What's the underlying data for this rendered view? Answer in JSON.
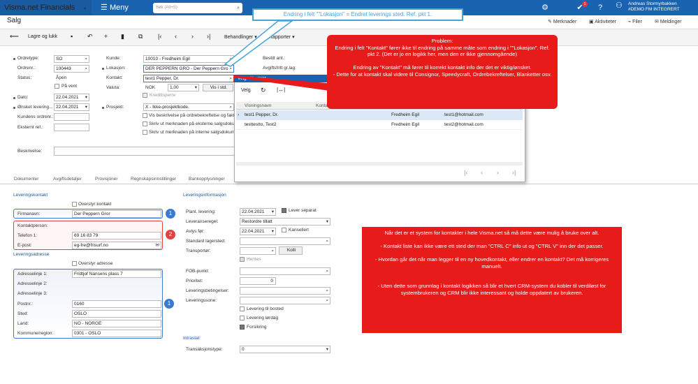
{
  "topbar": {
    "brand": "Visma.net Financials",
    "brand_chev": "⌄",
    "menu_label": "Meny",
    "search_placeholder": "Søk (Alt+S)",
    "user_name": "Andreas Stormyrbakken",
    "user_company": "#DEMO FM INTEGRERT",
    "notif_count": "1"
  },
  "header": {
    "title": "Salg",
    "buttons": [
      "Merknader",
      "Aktiviteter",
      "Filer",
      "Meldinger"
    ]
  },
  "toolbar": {
    "save_close": "Lagre og lukk",
    "actions": "Behandlinger",
    "reports": "Rapporter"
  },
  "form": {
    "ordertype_label": "Ordretype:",
    "ordertype": "SO",
    "ordernr_label": "Ordrenr.:",
    "ordernr": "100443",
    "status_label": "Status:",
    "status": "Åpen",
    "paavent": "På vent",
    "dato_label": "Dato:",
    "dato": "22.04.2021",
    "onsket_label": "Ønsket levering...",
    "onsket": "22.04.2021",
    "kundens_label": "Kundens ordrenr.:",
    "ekstern_label": "Eksternt ref.:",
    "kunde_label": "Kunde:",
    "kunde": "10010 - Fredheim Egil",
    "lokasjon_label": "Lokasjon:",
    "lokasjon": "DER PEPPERN GRO - Der Peppern Gro",
    "kontakt_label": "Kontakt:",
    "kontakt": "test1 Pepper, Dr.",
    "valuta_label": "Valuta:",
    "valuta": "NOK",
    "kurs": "1,00",
    "vis_std": "Vis i std.",
    "kredittsperre": "Kredittsperre",
    "prosjekt_label": "Prosjekt:",
    "prosjekt": "X - Ikke-prosjektkode.",
    "vis_besk": "Vis beskrivelse på ordrebekreftelse og faktura",
    "skriv_eksterne": "Skriv ut merknaden på eksterne salgsdokumenter",
    "skriv_interne": "Skriv ut merknaden på interne salgsdokumenter",
    "bestilt_label": "Bestilt ant.:",
    "avgift_label": "Avgiftsfritt gr.lag:",
    "beskrivelse_label": "Beskrivelse:"
  },
  "tabs": [
    "Dokumenter",
    "Avgiftsdetaljer",
    "Provisjoner",
    "Regnskapsinnstillinger",
    "Bankopplysninger"
  ],
  "popup": {
    "header": "Velg - Kontakt",
    "velg": "Velg",
    "col1": "Visningsnavn",
    "col2": "Kontakt",
    "rows": [
      {
        "name": "test1 Pepper, Dr.",
        "customer": "Fredheim Egil",
        "email": "test1@hotmail.com"
      },
      {
        "name": "testtestto, Test2",
        "customer": "Fredheim Egil",
        "email": "test2@hotmail.com"
      }
    ]
  },
  "leveringskontakt": {
    "title": "Leveringskontakt",
    "overstyr": "Overstyr kontakt",
    "firmanavn_label": "Firmanavn:",
    "firmanavn": "Der Peppern Gror",
    "kontaktperson_label": "Kontaktperson:",
    "telefon_label": "Telefon 1:",
    "telefon": "69 16 83 79",
    "epost_label": "E-post:",
    "epost": "eg-fre@frisurf.no"
  },
  "leveringsadresse": {
    "title": "Leveringsadresse",
    "overstyr": "Overstyr adresse",
    "a1_label": "Adresselinje 1:",
    "a1": "Fridtjof Nansens plass 7",
    "a2_label": "Adresselinje 2:",
    "a3_label": "Adresselinje 3:",
    "postnr_label": "Postnr.:",
    "postnr": "0160",
    "sted_label": "Sted:",
    "sted": "OSLO",
    "land_label": "Land:",
    "land": "NO - NORGE",
    "kommune_label": "Kommune/region:",
    "kommune": "0301 - OSLO"
  },
  "leveringsinfo": {
    "title": "Leveringsinformasjon",
    "planl_label": "Planl. levering:",
    "planl": "22.04.2021",
    "lever_separat": "Lever separat",
    "leveranseregel_label": "Leveranseregel:",
    "leveranseregel": "Restordre tillatt",
    "avlys_label": "Avlys før:",
    "avlys": "22.04.2021",
    "kansellert": "Kansellert",
    "standard_label": "Standard lagersted:",
    "transportor_label": "Transportør:",
    "kolli": "Kolli",
    "hentes": "Hentes",
    "fob_label": "FOB-punkt:",
    "prioritet_label": "Prioritet:",
    "prioritet": "0",
    "betingelser_label": "Leveringsbetingelser:",
    "sone_label": "Leveringssone:",
    "bosted": "Levering til bosted",
    "lordag": "Levering lørdag",
    "forsikring": "Forsikring"
  },
  "intrastat": {
    "title": "Intrastat",
    "type_label": "Transaksjonstype:",
    "type": "0"
  },
  "annotations": {
    "top": "Endring i felt \"\"Lokasjon\" = Endret leverings sted. Ref. pkt 1.",
    "problem": "Problem:\nEndring i felt \"Kontakt\" fører ikke til endring på samme måte som endring i \"\"Lokasjon\". Ref. pkt 2. (Det er jo en logikk her, men den er ikke gjennomgående)\n\nEndring av \"Kontakt\" må fører til korrekt kontakt info der det er viktig/ønsket.\n- Dette for at kontakt skal videre til Consignor, Speedycraft, Ordrebekreftelser, Blanketter osv.",
    "right": "Når det er et system for kontakter i hele Visma.net så må dette være mulig å bruke over alt.\n\n- Kontakt liste kan ikke være ett sted der man \"CTRL C\" info ut og \"CTRL V\" inn der det passer.\n\n- Hvordan går det når man legger til en ny hovedkontakt, eller endrer en kontakt? Det må korrigeres manuelt.\n\n\n- Uten dette som grunnlag i kontakt logikken så blir et hvert CRM-system du kobler til verdiløst for systembrukeren og CRM blir ikke interessant og holde oppdatert av brukeren.",
    "c1": "1",
    "c2": "2",
    "c3": "1"
  },
  "colors": {
    "brand": "#1a63b0",
    "callout": "#e81b1b",
    "frame_blue": "#3a7ad0"
  }
}
